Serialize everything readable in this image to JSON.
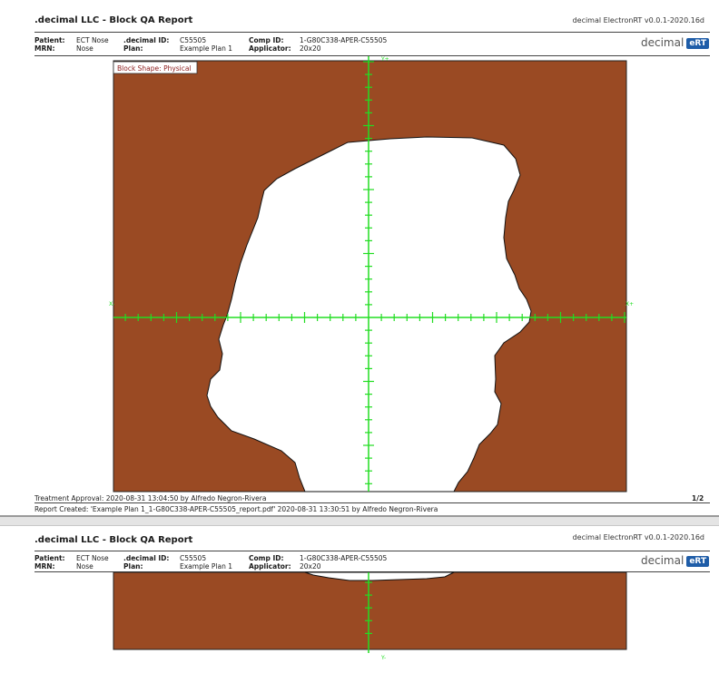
{
  "report_title": ".decimal LLC - Block QA Report",
  "software_version": "decimal ElectronRT v0.0.1-2020.16d",
  "logo": {
    "text": "decimal",
    "badge": "eRT"
  },
  "header": {
    "patient_label": "Patient:",
    "patient_value": "ECT Nose",
    "mrn_label": "MRN:",
    "mrn_value": "Nose",
    "decimal_id_label": ".decimal ID:",
    "decimal_id_value": "C55505",
    "plan_label": "Plan:",
    "plan_value": "Example Plan 1",
    "comp_id_label": "Comp ID:",
    "comp_id_value": "1-G80C338-APER-C55505",
    "applicator_label": "Applicator:",
    "applicator_value": "20x20"
  },
  "block_shape_label": "Block Shape: Physical",
  "axis_labels": {
    "x_minus": "X-",
    "x_plus": "X+",
    "y_plus": "Y+",
    "y_minus": "Y-"
  },
  "footer": {
    "treatment_approval": "Treatment Approval: 2020-08-31 13:04:50 by Alfredo Negron-Rivera",
    "page_number": "1/2",
    "report_created": "Report Created: 'Example Plan 1_1-G80C338-APER-C55505_report.pdf' 2020-08-31 13:30:51 by Alfredo Negron-Rivera"
  },
  "colors": {
    "block": "#9a4a23",
    "crosshair": "#22dd22",
    "badge": "#1f5da8",
    "label_text": "#8b1a1a"
  }
}
